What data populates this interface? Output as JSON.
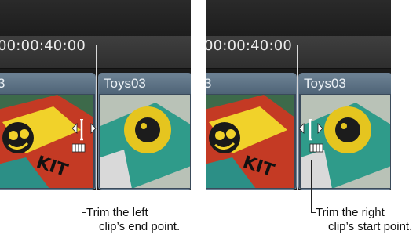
{
  "panels": [
    {
      "timecode": "00:00:40:00",
      "left_clip_label": "3",
      "right_clip_label": "Toys03",
      "caption_line1": "Trim the left",
      "caption_line2": "clip’s end point."
    },
    {
      "timecode": "00:00:40:00",
      "left_clip_label": "3",
      "right_clip_label": "Toys03",
      "caption_line1": "Trim the right",
      "caption_line2": "clip’s start point."
    }
  ],
  "colors": {
    "clip_header": "#5d7387",
    "playhead": "#d8d8d8",
    "background": "#141414"
  },
  "icons": [
    "playhead-icon",
    "trim-bracket-icon",
    "film-trim-icon"
  ]
}
